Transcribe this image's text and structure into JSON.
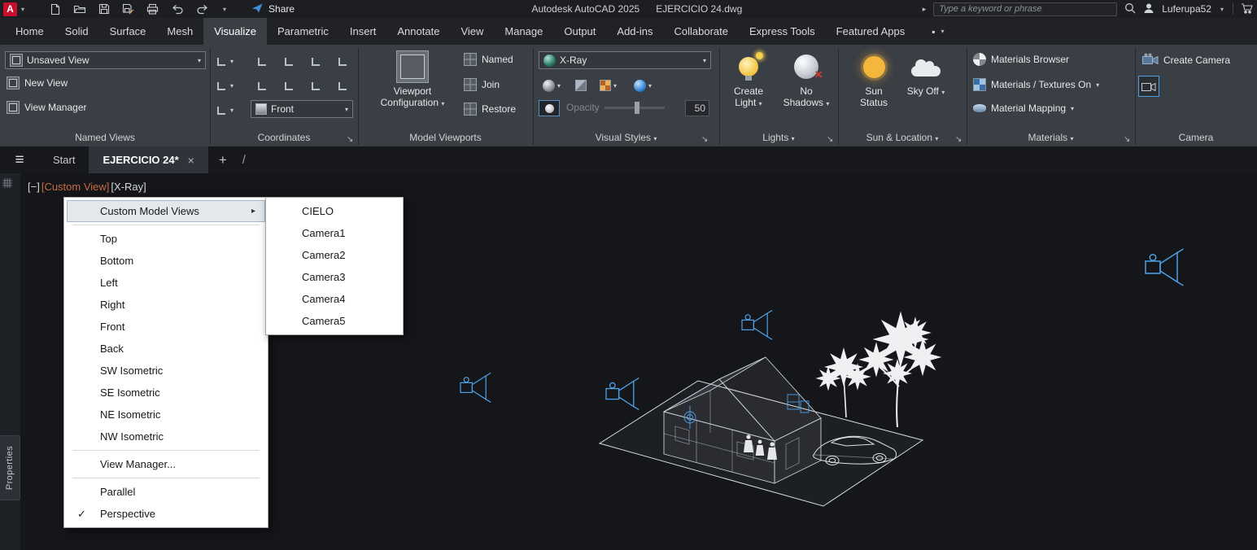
{
  "colors": {
    "accent_blue": "#2f7fd0",
    "autocad_red": "#c8102e",
    "viewport_label_orange": "#c96b43",
    "sun_yellow": "#f5b63c",
    "camera_wire_blue": "#4da0e8"
  },
  "icons": {
    "caret": "▾",
    "submenu_arrow": "▸",
    "check": "✓",
    "close": "×",
    "plus": "+",
    "hamburger": "≡",
    "slash": "/",
    "launcher": "↘",
    "chevron_right": "▸",
    "red_cross": "×",
    "ribbon_min_square": "▪"
  },
  "titlebar": {
    "app_button": "A",
    "share_label": "Share",
    "app_title": "Autodesk AutoCAD 2025",
    "doc_title": "EJERCICIO 24.dwg",
    "search_placeholder": "Type a keyword or phrase",
    "username": "Luferupa52"
  },
  "ribbon": {
    "tabs": [
      "Home",
      "Solid",
      "Surface",
      "Mesh",
      "Visualize",
      "Parametric",
      "Insert",
      "Annotate",
      "View",
      "Manage",
      "Output",
      "Add-ins",
      "Collaborate",
      "Express Tools",
      "Featured Apps"
    ],
    "active_tab": "Visualize",
    "named_views": {
      "title": "Named Views",
      "view_combo": "Unsaved View",
      "new_view": "New View",
      "view_manager": "View Manager"
    },
    "coordinates": {
      "title": "Coordinates",
      "front_combo": "Front"
    },
    "model_viewports": {
      "title": "Model Viewports",
      "viewport_config": "Viewport Configuration",
      "named": "Named",
      "join": "Join",
      "restore": "Restore"
    },
    "visual_styles": {
      "title": "Visual Styles",
      "style_combo": "X-Ray",
      "opacity_label": "Opacity",
      "opacity_value": "50"
    },
    "lights": {
      "title": "Lights",
      "create_light": "Create Light",
      "no_shadows": "No Shadows"
    },
    "sun_location": {
      "title": "Sun & Location",
      "sun_status": "Sun Status",
      "sky_off": "Sky Off"
    },
    "materials": {
      "title": "Materials",
      "browser": "Materials Browser",
      "textures_on": "Materials / Textures On",
      "mapping": "Material Mapping"
    },
    "camera": {
      "title": "Camera",
      "create_camera": "Create Camera"
    }
  },
  "doc_tabs": {
    "start": "Start",
    "active": "EJERCICIO 24*"
  },
  "viewport_controls": {
    "minimize": "[−]",
    "custom_view": "[Custom View]",
    "visual_style": "[X-Ray]"
  },
  "context_menu": {
    "items": [
      {
        "label": "Custom Model Views"
      },
      {
        "label": "Top"
      },
      {
        "label": "Bottom"
      },
      {
        "label": "Left"
      },
      {
        "label": "Right"
      },
      {
        "label": "Front"
      },
      {
        "label": "Back"
      },
      {
        "label": "SW Isometric"
      },
      {
        "label": "SE Isometric"
      },
      {
        "label": "NE Isometric"
      },
      {
        "label": "NW Isometric"
      },
      {
        "label": "View Manager..."
      },
      {
        "label": "Parallel"
      },
      {
        "label": "Perspective"
      }
    ]
  },
  "submenu": {
    "items": [
      "CIELO",
      "Camera1",
      "Camera2",
      "Camera3",
      "Camera4",
      "Camera5"
    ]
  },
  "side_palette": {
    "label": "Properties"
  }
}
